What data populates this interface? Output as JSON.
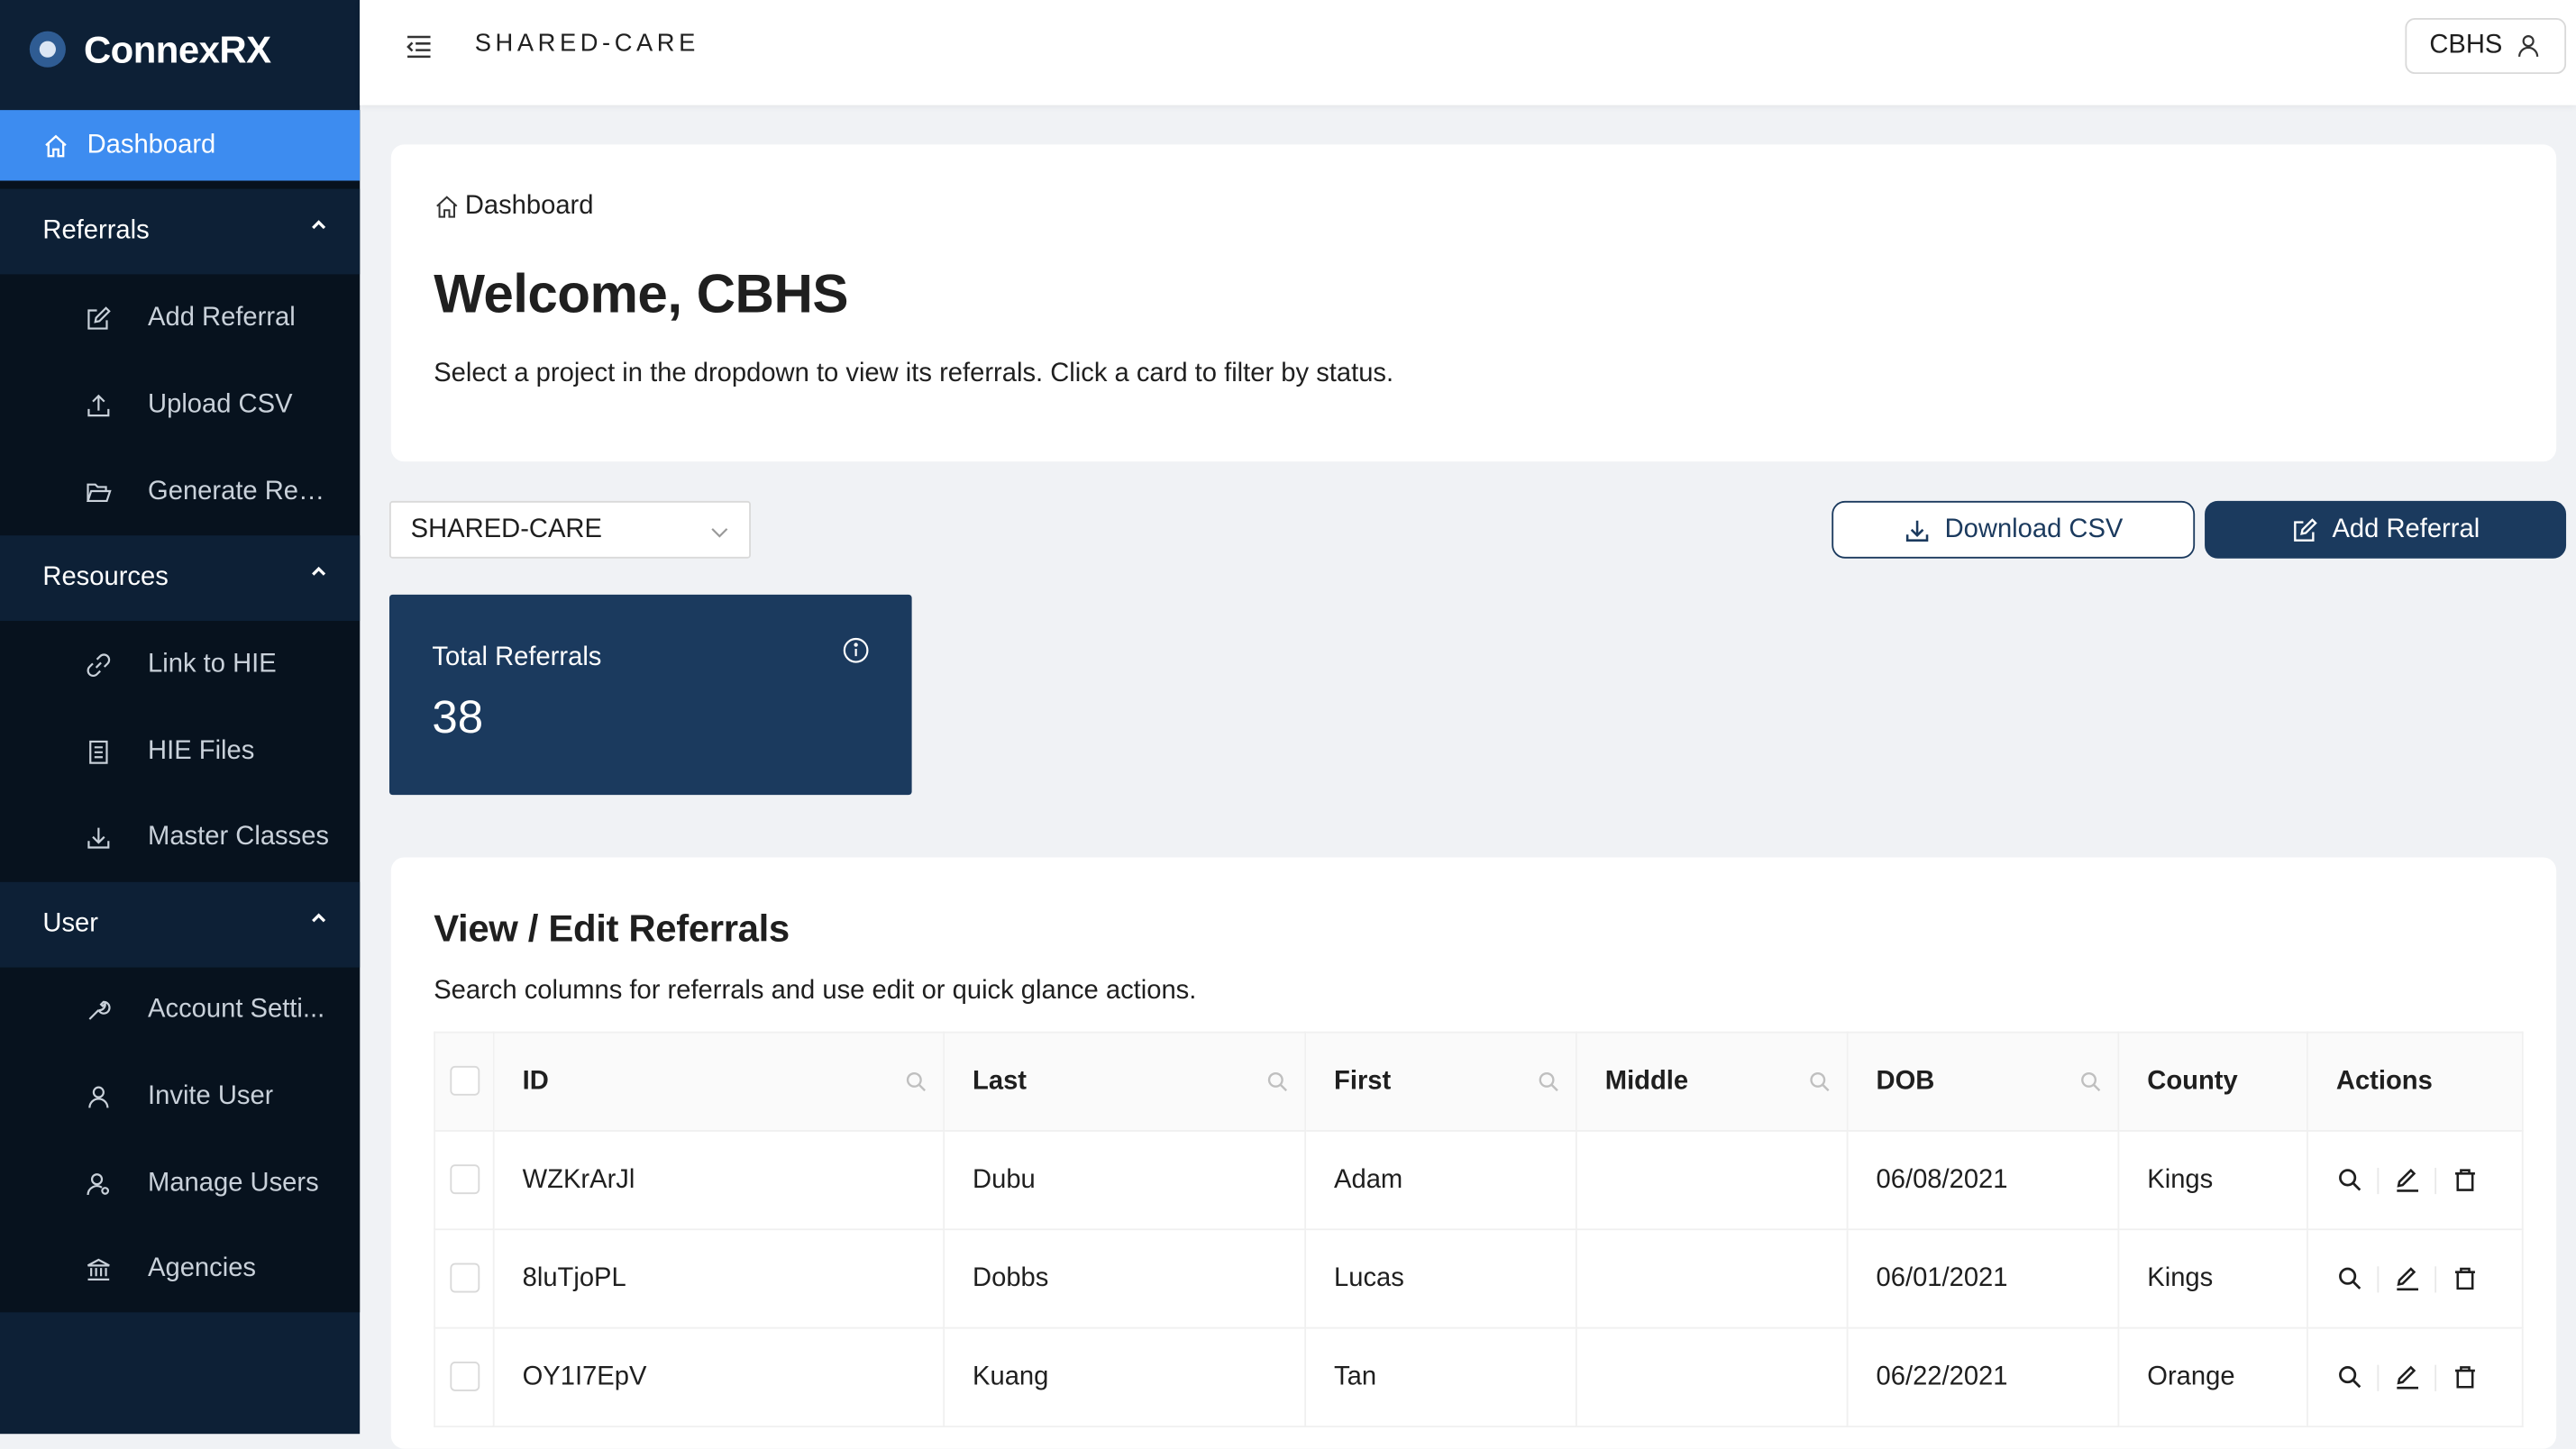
{
  "app": {
    "name": "ConnexRX"
  },
  "sidebar": {
    "dashboard": "Dashboard",
    "groups": {
      "referrals": {
        "label": "Referrals",
        "items": [
          "Add Referral",
          "Upload CSV",
          "Generate Rep..."
        ]
      },
      "resources": {
        "label": "Resources",
        "items": [
          "Link to HIE",
          "HIE Files",
          "Master Classes"
        ]
      },
      "user": {
        "label": "User",
        "items": [
          "Account Setti...",
          "Invite User",
          "Manage Users",
          "Agencies"
        ]
      }
    }
  },
  "header": {
    "title": "SHARED-CARE",
    "user_label": "CBHS"
  },
  "welcome": {
    "breadcrumb": "Dashboard",
    "title": "Welcome, CBHS",
    "subtitle": "Select a project in the dropdown to view its referrals. Click a card to filter by status."
  },
  "toolbar": {
    "project_selected": "SHARED-CARE",
    "download_label": "Download CSV",
    "add_label": "Add Referral"
  },
  "stats": {
    "total_label": "Total Referrals",
    "total_value": "38"
  },
  "referrals_table": {
    "title": "View / Edit Referrals",
    "subtitle": "Search columns for referrals and use edit or quick glance actions.",
    "columns": [
      "ID",
      "Last",
      "First",
      "Middle",
      "DOB",
      "County",
      "Actions"
    ],
    "rows": [
      {
        "id": "WZKrArJl",
        "last": "Dubu",
        "first": "Adam",
        "middle": "",
        "dob": "06/08/2021",
        "county": "Kings"
      },
      {
        "id": "8luTjoPL",
        "last": "Dobbs",
        "first": "Lucas",
        "middle": "",
        "dob": "06/01/2021",
        "county": "Kings"
      },
      {
        "id": "OY1I7EpV",
        "last": "Kuang",
        "first": "Tan",
        "middle": "",
        "dob": "06/22/2021",
        "county": "Orange"
      }
    ]
  },
  "colors": {
    "sidebar_bg": "#0d2036",
    "active_item": "#3d8cf0",
    "primary": "#1b3a5e"
  }
}
